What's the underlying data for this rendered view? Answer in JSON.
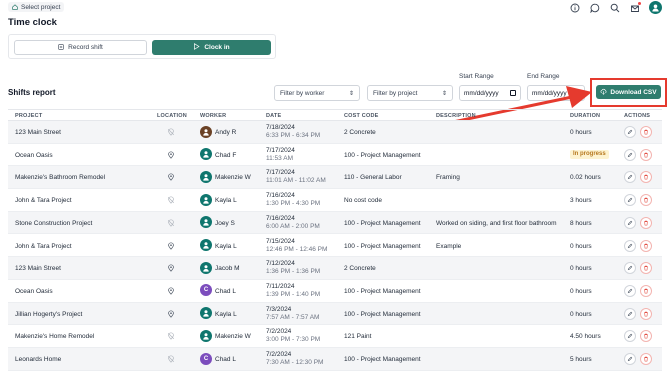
{
  "topbar": {
    "select_project": "Select project"
  },
  "page_title": "Time clock",
  "clock_card": {
    "record_shift": "Record shift",
    "clock_in": "Clock in"
  },
  "shifts": {
    "title": "Shifts report",
    "filter_worker": "Filter by worker",
    "filter_project": "Filter by project",
    "start_range_label": "Start Range",
    "end_range_label": "End Range",
    "start_placeholder": "mm/dd/yyyy",
    "end_placeholder": "mm/dd/yyyy",
    "download_csv": "Download CSV"
  },
  "columns": [
    "PROJECT",
    "LOCATION",
    "WORKER",
    "DATE",
    "COST CODE",
    "DESCRIPTION",
    "DURATION",
    "ACTIONS"
  ],
  "rows": [
    {
      "project": "123 Main Street",
      "location": "off",
      "worker": "Andy R",
      "avatar": "photo",
      "avatar_color": "#6b4226",
      "date1": "7/18/2024",
      "date2": "6:33 PM - 6:34 PM",
      "cost_code": "2 Concrete",
      "description": "",
      "duration": "0 hours"
    },
    {
      "project": "Ocean Oasis",
      "location": "on",
      "worker": "Chad F",
      "avatar": "icon",
      "avatar_color": "#0f766e",
      "date1": "7/17/2024",
      "date2": "11:53 AM",
      "cost_code": "100 - Project Management",
      "description": "",
      "duration": "In progress"
    },
    {
      "project": "Makenzie's Bathroom Remodel",
      "location": "on",
      "worker": "Makenzie W",
      "avatar": "icon",
      "avatar_color": "#0f766e",
      "date1": "7/17/2024",
      "date2": "11:01 AM - 11:02 AM",
      "cost_code": "110 - General Labor",
      "description": "Framing",
      "duration": "0.02 hours"
    },
    {
      "project": "John & Tara Project",
      "location": "off",
      "worker": "Kayla L",
      "avatar": "icon",
      "avatar_color": "#0f766e",
      "date1": "7/16/2024",
      "date2": "1:30 PM - 4:30 PM",
      "cost_code": "No cost code",
      "description": "",
      "duration": "3 hours"
    },
    {
      "project": "Stone Construction Project",
      "location": "off",
      "worker": "Joey S",
      "avatar": "icon",
      "avatar_color": "#0f766e",
      "date1": "7/16/2024",
      "date2": "6:00 AM - 2:00 PM",
      "cost_code": "100 - Project Management",
      "description": "Worked on siding, and first floor bathroom",
      "duration": "8 hours"
    },
    {
      "project": "John & Tara Project",
      "location": "on",
      "worker": "Kayla L",
      "avatar": "icon",
      "avatar_color": "#0f766e",
      "date1": "7/15/2024",
      "date2": "12:46 PM - 12:46 PM",
      "cost_code": "100 - Project Management",
      "description": "Example",
      "duration": "0 hours"
    },
    {
      "project": "123 Main Street",
      "location": "on",
      "worker": "Jacob M",
      "avatar": "icon",
      "avatar_color": "#0f766e",
      "date1": "7/12/2024",
      "date2": "1:36 PM - 1:36 PM",
      "cost_code": "2 Concrete",
      "description": "",
      "duration": "0 hours"
    },
    {
      "project": "Ocean Oasis",
      "location": "on",
      "worker": "Chad L",
      "avatar": "letter",
      "avatar_color": "#7c4dbd",
      "date1": "7/11/2024",
      "date2": "1:39 PM - 1:40 PM",
      "cost_code": "100 - Project Management",
      "description": "",
      "duration": "0 hours"
    },
    {
      "project": "Jillian Hogerty's Project",
      "location": "on",
      "worker": "Kayla L",
      "avatar": "icon",
      "avatar_color": "#0f766e",
      "date1": "7/3/2024",
      "date2": "7:57 AM - 7:57 AM",
      "cost_code": "100 - Project Management",
      "description": "",
      "duration": "0 hours"
    },
    {
      "project": "Makenzie's Home Remodel",
      "location": "off",
      "worker": "Makenzie W",
      "avatar": "icon",
      "avatar_color": "#0f766e",
      "date1": "7/2/2024",
      "date2": "3:00 PM - 7:30 PM",
      "cost_code": "121 Paint",
      "description": "",
      "duration": "4.50 hours"
    },
    {
      "project": "Leonards Home",
      "location": "off",
      "worker": "Chad L",
      "avatar": "letter",
      "avatar_color": "#7c4dbd",
      "date1": "7/2/2024",
      "date2": "7:30 AM - 12:30 PM",
      "cost_code": "100 - Project Management",
      "description": "",
      "duration": "5 hours"
    }
  ],
  "colors": {
    "accent": "#2f7d6e",
    "annotation": "#e53a2e",
    "in_progress_bg": "#fdf3d0",
    "in_progress_text": "#b7791f"
  }
}
